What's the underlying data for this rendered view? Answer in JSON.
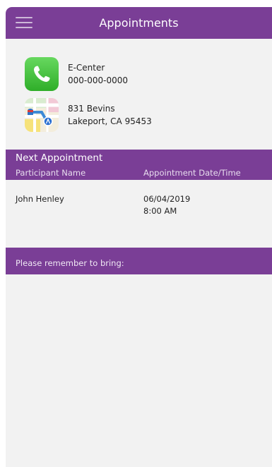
{
  "header": {
    "title": "Appointments",
    "menu_icon": "hamburger-menu-icon"
  },
  "contacts": {
    "phone": {
      "icon": "phone-icon",
      "name": "E-Center",
      "number": "000-000-0000"
    },
    "address": {
      "icon": "map-icon",
      "street": "831 Bevins",
      "city": "Lakeport, CA 95453"
    }
  },
  "next_appointment": {
    "title": "Next Appointment",
    "columns": [
      "Participant Name",
      "Appointment Date/Time"
    ],
    "rows": [
      {
        "participant": "John Henley",
        "date": "06/04/2019",
        "time": "8:00 AM"
      }
    ]
  },
  "bring": {
    "label": "Please remember to bring:"
  },
  "colors": {
    "brand_purple": "#7a3e96",
    "background": "#f2f2f2",
    "phone_green": "#3cb934"
  }
}
